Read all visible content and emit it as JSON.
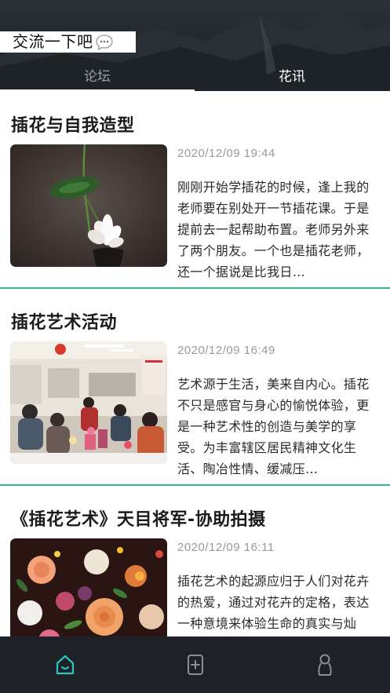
{
  "header": {
    "title": "交流一下吧",
    "title_icon": "chat-bubble-icon",
    "tabs": [
      {
        "label": "论坛",
        "selected": false
      },
      {
        "label": "花讯",
        "selected": true
      }
    ]
  },
  "articles": [
    {
      "title": "插花与自我造型",
      "date": "2020/12/09  19:44",
      "excerpt": "刚刚开始学插花的时候，逢上我的老师要在别处开一节插花课。于是提前去一起帮助布置。老师另外来了两个朋友。一个也是插花老师，还一个据说是比我日…"
    },
    {
      "title": "插花艺术活动",
      "date": "2020/12/09  16:49",
      "excerpt": "艺术源于生活，美来自内心。插花不只是感官与身心的愉悦体验，更是一种艺术性的创造与美学的享受。为丰富辖区居民精神文化生活、陶冶性情、缓减压…"
    },
    {
      "title": "《插花艺术》天目将军-协助拍摄",
      "date": "2020/12/09  16:11",
      "excerpt": "插花艺术的起源应归于人们对花卉的热爱，通过对花卉的定格，表达一种意境来体验生命的真实与灿烂，以花做为主要素材，在…"
    }
  ],
  "bottom_nav": [
    {
      "icon": "home-icon",
      "active": true
    },
    {
      "icon": "add-post-icon",
      "active": false
    },
    {
      "icon": "profile-icon",
      "active": false
    }
  ],
  "colors": {
    "accent": "#3fb48c",
    "nav_active": "#2ec4c4",
    "nav_inactive": "#8a8f93",
    "nav_bg": "#1e2226"
  }
}
